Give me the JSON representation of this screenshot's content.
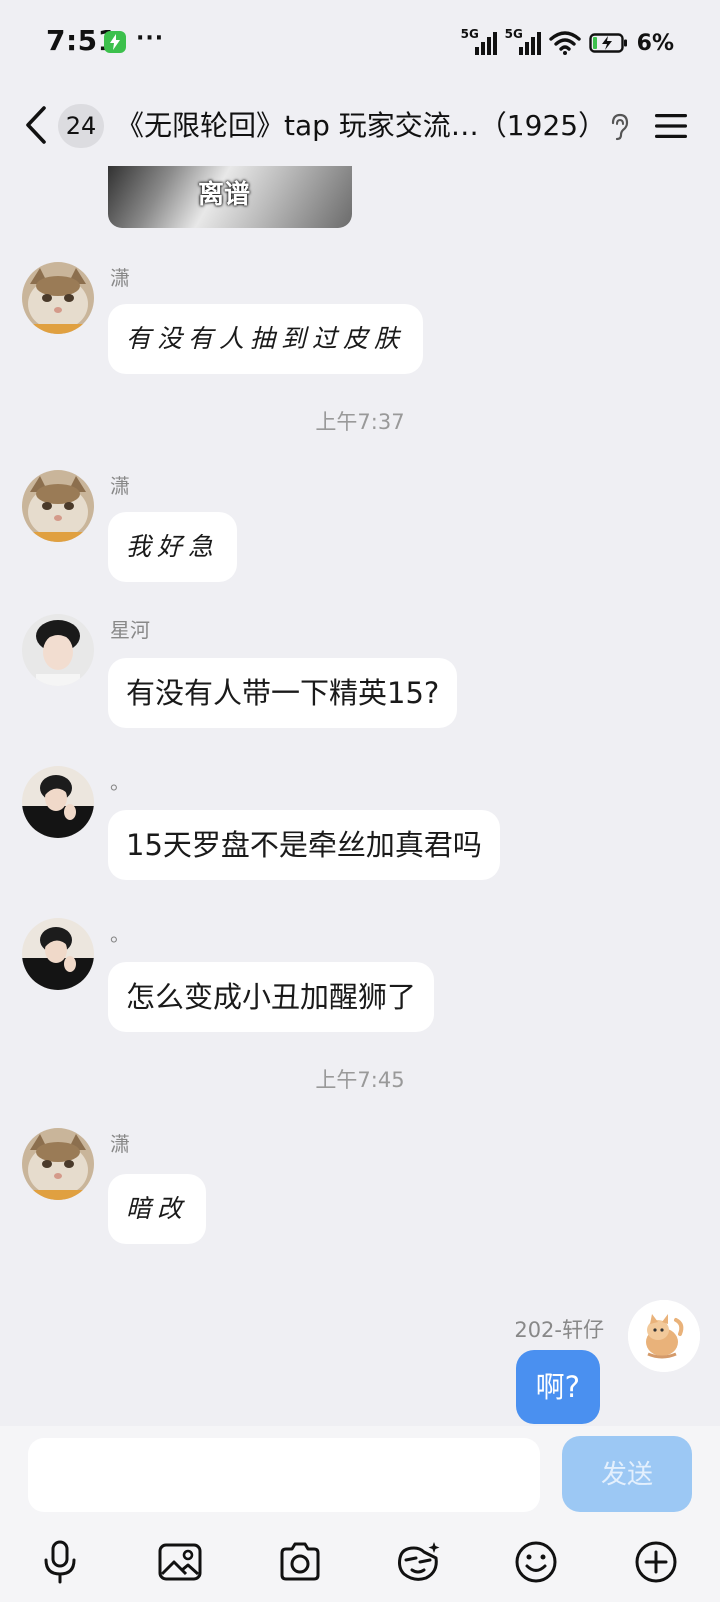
{
  "status_bar": {
    "time": "7:51",
    "dots": "···",
    "sim1_label": "5G",
    "sim2_label": "5G",
    "battery": "6%"
  },
  "header": {
    "unread_count": "24",
    "title": "《无限轮回》tap 玩家交流…（1925）"
  },
  "chat": {
    "image_caption": "离谱",
    "messages": [
      {
        "sender": "潇",
        "text": "有没有人抽到过皮肤",
        "style": "handwriting"
      },
      {
        "timestamp": "上午7:37"
      },
      {
        "sender": "潇",
        "text": "我好急",
        "style": "handwriting"
      },
      {
        "sender": "星河",
        "text": "有没有人带一下精英15?"
      },
      {
        "sender": "。",
        "text": "15天罗盘不是牵丝加真君吗"
      },
      {
        "sender": "。",
        "text": "怎么变成小丑加醒狮了"
      },
      {
        "timestamp": "上午7:45"
      },
      {
        "sender": "潇",
        "text": "暗改",
        "style": "handwriting"
      }
    ],
    "me": {
      "name": "202-轩仔",
      "text": "啊?"
    }
  },
  "input": {
    "placeholder": "",
    "send_label": "发送"
  },
  "toolbar_icons": [
    "microphone-icon",
    "image-icon",
    "camera-icon",
    "sticker-icon",
    "emoji-icon",
    "plus-icon"
  ],
  "colors": {
    "background": "#efeff3",
    "my_bubble": "#4a90f0",
    "send_button": "#9cc8f4"
  }
}
